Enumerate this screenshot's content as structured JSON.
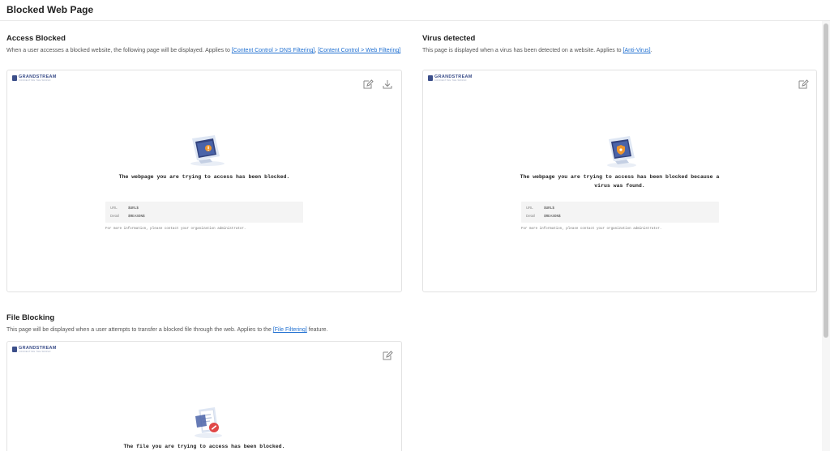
{
  "header": {
    "title": "Blocked Web Page"
  },
  "brand": {
    "name": "GRANDSTREAM",
    "tagline": "CONNECTING THE WORLD"
  },
  "sections": [
    {
      "title": "Access Blocked",
      "desc_prefix": "When a user accesses a blocked website, the following page will be displayed. Applies to ",
      "link1": "[Content Control > DNS Filtering]",
      "sep": ", ",
      "link2": "[Content Control > Web Filtering]",
      "desc_suffix": "",
      "preview": {
        "message": "The webpage you are trying to access has been blocked.",
        "url_label": "URL",
        "url_value": "$URL$",
        "detail_label": "Detail",
        "detail_value": "$REASON$",
        "footnote": "For more information, please contact your organization administrator."
      }
    },
    {
      "title": "Virus detected",
      "desc_prefix": "This page is displayed when a virus has been detected on a website. Applies to ",
      "link1": "[Anti-Virus]",
      "desc_suffix": ".",
      "preview": {
        "message_line1": "The webpage you are trying to access has been blocked because a",
        "message_line2": "virus was found.",
        "url_label": "URL",
        "url_value": "$URL$",
        "detail_label": "Detail",
        "detail_value": "$REASON$",
        "footnote": "For more information, please contact your organization administrator."
      }
    },
    {
      "title": "File Blocking",
      "desc_prefix": "This page will be displayed when a user attempts to transfer a blocked file through the web. Applies to the ",
      "link1": "[File Filtering]",
      "desc_suffix": " feature.",
      "preview": {
        "message": "The file you are trying to access has been blocked."
      }
    }
  ],
  "icons": {
    "edit": "edit-icon",
    "download": "download-icon"
  },
  "colors": {
    "link": "#1f6fd1",
    "brand": "#3c4f8a",
    "warning": "#f0962c",
    "blocked": "#e04848"
  }
}
